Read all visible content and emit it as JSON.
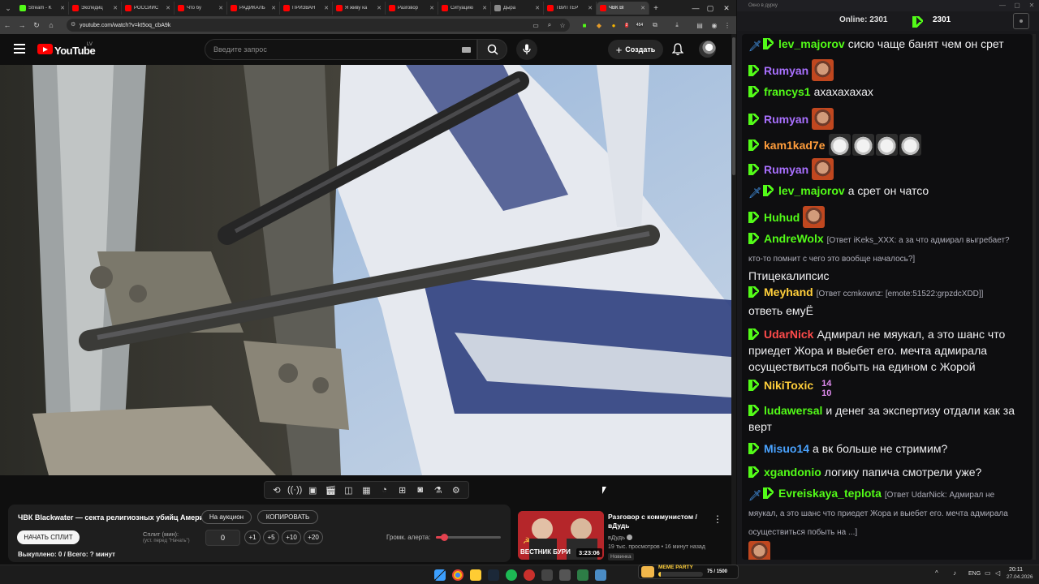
{
  "browser": {
    "tabs": [
      {
        "label": "Stream - K",
        "color": "#53fc18"
      },
      {
        "label": "Экспедиц",
        "color": "#ff0000"
      },
      {
        "label": "РОССИЙС",
        "color": "#ff0000"
      },
      {
        "label": "Что бу",
        "color": "#ff0000"
      },
      {
        "label": "РАДИКАЛЬ",
        "color": "#ff0000"
      },
      {
        "label": "ПРИЗВАН",
        "color": "#ff0000"
      },
      {
        "label": "Я живу ка",
        "color": "#ff0000"
      },
      {
        "label": "Разговор",
        "color": "#ff0000"
      },
      {
        "label": "Ситуацию",
        "color": "#ff0000"
      },
      {
        "label": "Дыра",
        "color": "#8a8a8a"
      },
      {
        "label": "ТВИТТЕР",
        "color": "#ff0000"
      },
      {
        "label": "ЧВК Bl",
        "color": "#ff0000"
      }
    ],
    "url": "youtube.com/watch?v=kt5oq_cbA9k",
    "ext_badge_a": "2",
    "ext_badge_b": "454"
  },
  "youtube": {
    "wordmark": "YouTube",
    "region": "LV",
    "search_placeholder": "Введите запрос",
    "create_label": "Создать"
  },
  "auction": {
    "title": "ЧВК Blackwater — секта религиозных убийц Америки!",
    "to_auction_label": "На аукцион",
    "copy_label": "КОПИРОВАТЬ",
    "start_split_label": "НАЧАТЬ СПЛИТ",
    "split_label": "Сплит (мин):",
    "split_hint": "(уст. перед \"Начать\")",
    "split_value": "0",
    "increments": [
      "+1",
      "+5",
      "+10",
      "+20"
    ],
    "volume_label": "Громк. алерта:",
    "volume_level": 0.12,
    "bought": "Выкуплено: 0 / Всего: ? минут"
  },
  "recommendation": {
    "title": "Разговор с коммунистом / вДудь",
    "channel": "вДудь",
    "meta": "19 тыс. просмотров • 16 минут назад",
    "badge": "Новинка",
    "duration": "3:23:06",
    "thumb_text": "ВЕСТНИК БУРИ"
  },
  "chat": {
    "window_title": "Окно в дурку",
    "online_label": "Online: 2301",
    "kick_count": "2301",
    "messages": [
      {
        "user": "lev_majorov",
        "color": "#53fc18",
        "mod": true,
        "text": "сисю чаще банят чем он срет"
      },
      {
        "user": "Rumyan",
        "color": "#a970ff",
        "emotes": [
          "face"
        ],
        "text": ""
      },
      {
        "user": "francys1",
        "color": "#53fc18",
        "text": "ахахахахах"
      },
      {
        "user": "Rumyan",
        "color": "#a970ff",
        "emotes": [
          "face"
        ],
        "text": ""
      },
      {
        "user": "kam1kad7e",
        "color": "#ff9d3c",
        "emotes": [
          "cat",
          "cat",
          "cat",
          "cat"
        ],
        "text": ""
      },
      {
        "user": "Rumyan",
        "color": "#a970ff",
        "emotes": [
          "face"
        ],
        "text": ""
      },
      {
        "user": "lev_majorov",
        "color": "#53fc18",
        "mod": true,
        "text": "а срет он чатсо"
      },
      {
        "user": "Huhud",
        "color": "#53fc18",
        "emotes": [
          "face"
        ],
        "text": ""
      },
      {
        "user": "AndreWolx",
        "color": "#53fc18",
        "reply": "[Ответ iKeks_XXX: а за что адмирал выгребает? кто-то помнит с чего это вообще началось?]",
        "text": "Птицекалипсис"
      },
      {
        "user": "Meyhand",
        "color": "#ffcf3b",
        "reply": "[Ответ ccmkownz: [emote:51522:grpzdcXDD]]",
        "text": "ответь емуЁ"
      },
      {
        "user": "UdarNick",
        "color": "#ff4b4b",
        "text": "Адмирал не мяукал, а это шанс что приедет Жора и выебет его. мечта адмирала осуществиться побыть на едином с Жорой"
      },
      {
        "user": "NikiToxic",
        "color": "#ffcf3b",
        "emotes": [
          "1410"
        ],
        "text": ""
      },
      {
        "user": "ludawersal",
        "color": "#53fc18",
        "text": "и денег за экспертизу отдали как за верт"
      },
      {
        "user": "Misuo14",
        "color": "#4aa3ff",
        "text": "а вк больше не стримим?"
      },
      {
        "user": "xgandonio",
        "color": "#53fc18",
        "text": "логику папича смотрели уже?"
      },
      {
        "user": "Evreiskaya_teplota",
        "color": "#53fc18",
        "mod": true,
        "reply": "[Ответ UdarNick: Адмирал не мяукал, а это шанс что приедет Жора и выебет его. мечта адмирала осуществиться побыть на ...]",
        "text": ""
      }
    ]
  },
  "taskbar": {
    "lang": "ENG",
    "time": "20:11",
    "date": "27.04.2026",
    "meme_label": "MEME PARTY",
    "meme_count": "75 / 1500",
    "meme_progress": 0.05
  }
}
